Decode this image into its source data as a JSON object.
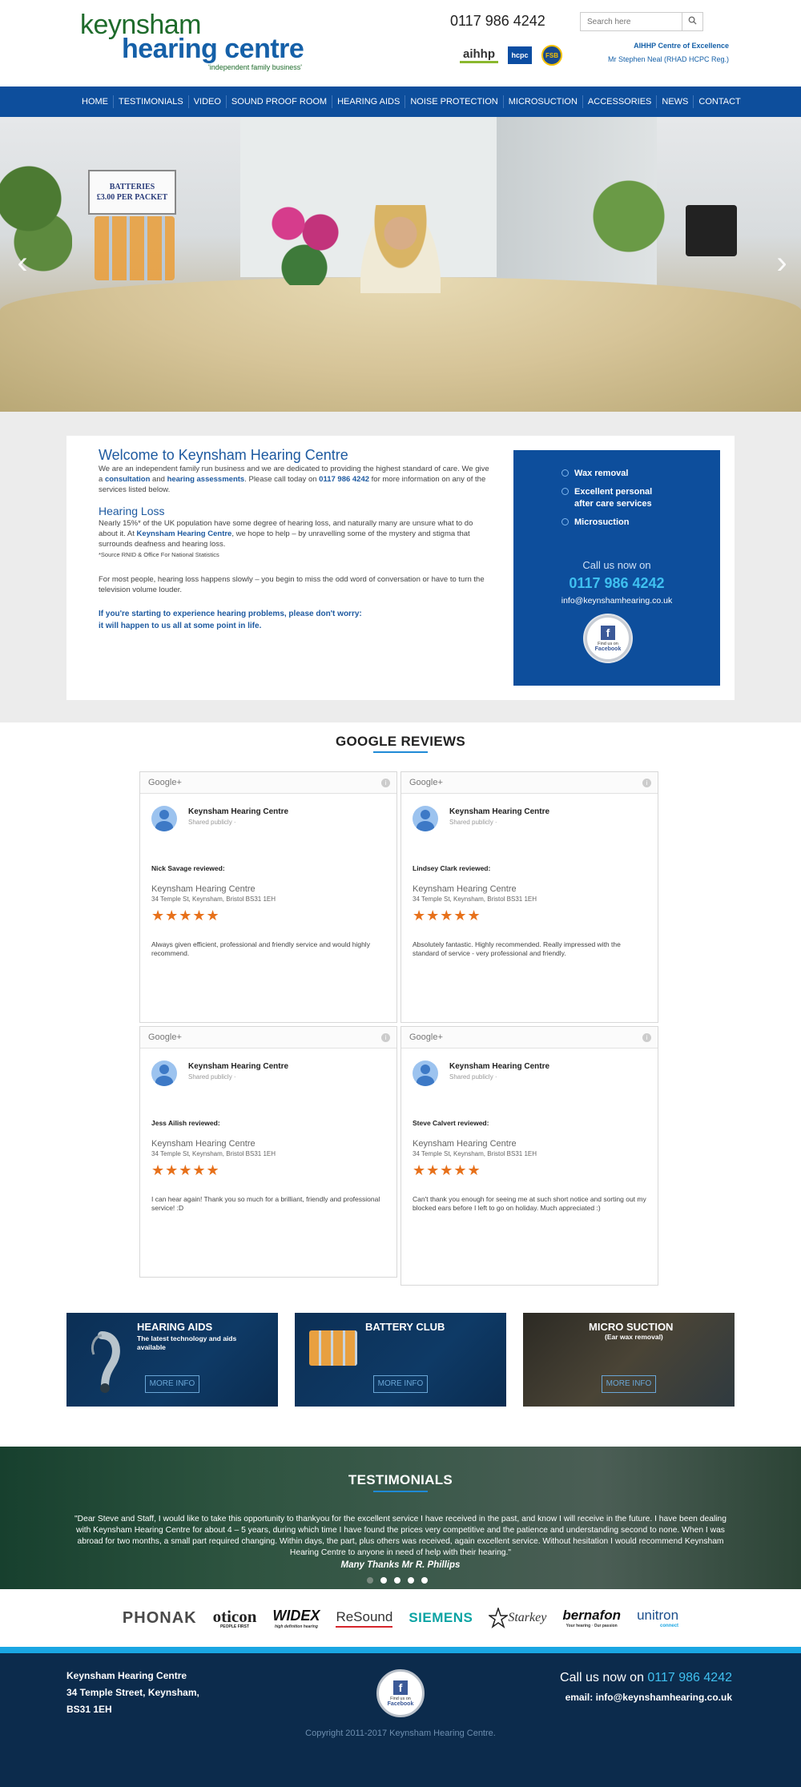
{
  "header": {
    "logo": {
      "line1": "keynsham",
      "line2": "hearing centre",
      "tagline": "'independent family business'"
    },
    "phone": "0117 986 4242",
    "search_placeholder": "Search here",
    "badges": [
      "aihhp",
      "hcpc",
      "FSB"
    ],
    "centre_line1": "AIHHP Centre of Excellence",
    "centre_line2": "Mr Stephen Neal (RHAD HCPC Reg.)"
  },
  "nav": {
    "items": [
      {
        "label": "HOME"
      },
      {
        "label": "TESTIMONIALS"
      },
      {
        "label": "VIDEO"
      },
      {
        "label": "SOUND PROOF ROOM"
      },
      {
        "label": "HEARING AIDS"
      },
      {
        "label": "NOISE PROTECTION"
      },
      {
        "label": "MICROSUCTION"
      },
      {
        "label": "ACCESSORIES"
      },
      {
        "label": "NEWS"
      },
      {
        "label": "CONTACT"
      }
    ]
  },
  "hero": {
    "sign_line1": "BATTERIES",
    "sign_line2": "£3.00 PER PACKET",
    "prev_arrow": "‹",
    "next_arrow": "›"
  },
  "welcome": {
    "title": "Welcome to Keynsham Hearing Centre",
    "intro_a": "We are an independent family run business and we are dedicated to providing the highest standard of care. We give a ",
    "intro_link1": "consultation",
    "intro_b": " and ",
    "intro_link2": "hearing assessments",
    "intro_c": ". Please call today on ",
    "intro_phone": "0117 986 4242",
    "intro_d": " for more information on any of the services listed below.",
    "loss_title": "Hearing Loss",
    "loss_a": "Nearly 15%* of the UK population have some degree of hearing loss, and naturally many are unsure what to do about it. At ",
    "loss_link": "Keynsham Hearing Centre",
    "loss_b": ", we hope to help – by unravelling some of the mystery and stigma that surrounds deafness and hearing loss.",
    "source_note": "*Source RNID & Office For National Statistics",
    "para2": "For most people, hearing loss happens slowly – you begin to miss the odd word of conversation or have to turn the television volume louder.",
    "callout_line1": "If you're starting to experience hearing problems, please don't worry:",
    "callout_line2": "it will happen to us all at some point in life."
  },
  "services": {
    "items": [
      {
        "label": "Wax removal"
      },
      {
        "label": "Excellent personal after care services"
      },
      {
        "label": "Microsuction"
      }
    ],
    "call_label": "Call us now on",
    "phone": "0117 986 4242",
    "email": "info@keynshamhearing.co.uk",
    "fb_small": "Find us on",
    "fb_name": "Facebook",
    "fb_letter": "f"
  },
  "reviews": {
    "title": "GOOGLE REVIEWS",
    "google_label": "Google+",
    "info_glyph": "i",
    "business": "Keynsham Hearing Centre",
    "shared": "Shared publicly  ·",
    "address": "34 Temple St, Keynsham, Bristol BS31 1EH",
    "stars": "★★★★★",
    "items": [
      {
        "reviewer": "Nick Savage reviewed:",
        "text": "Always given efficient, professional and friendly service and would highly recommend."
      },
      {
        "reviewer": "Lindsey Clark reviewed:",
        "text": "Absolutely fantastic. Highly recommended. Really impressed with the standard of service - very professional and friendly."
      },
      {
        "reviewer": "Jess Ailish reviewed:",
        "text": "I can hear again! Thank you so much for a brilliant, friendly and professional service! :D"
      },
      {
        "reviewer": "Steve Calvert reviewed:",
        "text": "Can't thank you enough for seeing me at such short notice and sorting out my blocked ears before I left to go on holiday. Much appreciated :)"
      }
    ]
  },
  "promos": [
    {
      "title": "HEARING AIDS",
      "subtitle": "The latest technology and aids available",
      "button": "MORE INFO"
    },
    {
      "title": "BATTERY CLUB",
      "subtitle": "",
      "button": "MORE INFO"
    },
    {
      "title": "MICRO SUCTION",
      "subtitle": "(Ear wax removal)",
      "button": "MORE INFO"
    }
  ],
  "testimonials": {
    "title": "TESTIMONIALS",
    "quote": "\"Dear Steve and Staff, I would like to take this opportunity to thankyou for the excellent service I have received in the past, and know I will receive in the future. I have been dealing with Keynsham Hearing Centre for about 4 – 5 years, during which time I have found the prices very competitive and the patience and understanding second to none. When I was abroad for two months, a small part required changing. Within days, the part, plus others was received, again excellent service. Without hesitation I would recommend Keynsham Hearing Centre to anyone in need of help with their hearing.\"",
    "author": "Many Thanks Mr R. Phillips",
    "slides": 5,
    "active_slide": 1
  },
  "brands": {
    "phonak": "PHONAK",
    "oticon": "oticon",
    "oticon_sub": "PEOPLE FIRST",
    "widex": "WIDEX",
    "widex_sub": "high definition hearing",
    "resound": "ReSound",
    "siemens": "SIEMENS",
    "starkey": "Starkey",
    "bernafon": "bernafon",
    "bernafon_sub": "Your hearing · Our passion",
    "unitron": "unitron",
    "unitron_sub": "connect"
  },
  "footer": {
    "addr_line1": "Keynsham Hearing Centre",
    "addr_line2": "34 Temple Street, Keynsham,",
    "addr_line3": "BS31 1EH",
    "fb_small": "Find us on",
    "fb_name": "Facebook",
    "fb_letter": "f",
    "call_label": "Call us now on ",
    "phone": "0117 986 4242",
    "email": "email: info@keynshamhearing.co.uk",
    "copyright": "Copyright 2011-2017 Keynsham Hearing Centre."
  },
  "colors": {
    "primary_blue": "#0d4e9c",
    "accent_cyan": "#3fc0f0",
    "star_orange": "#e7711b",
    "footer_navy": "#0c2b4c"
  }
}
